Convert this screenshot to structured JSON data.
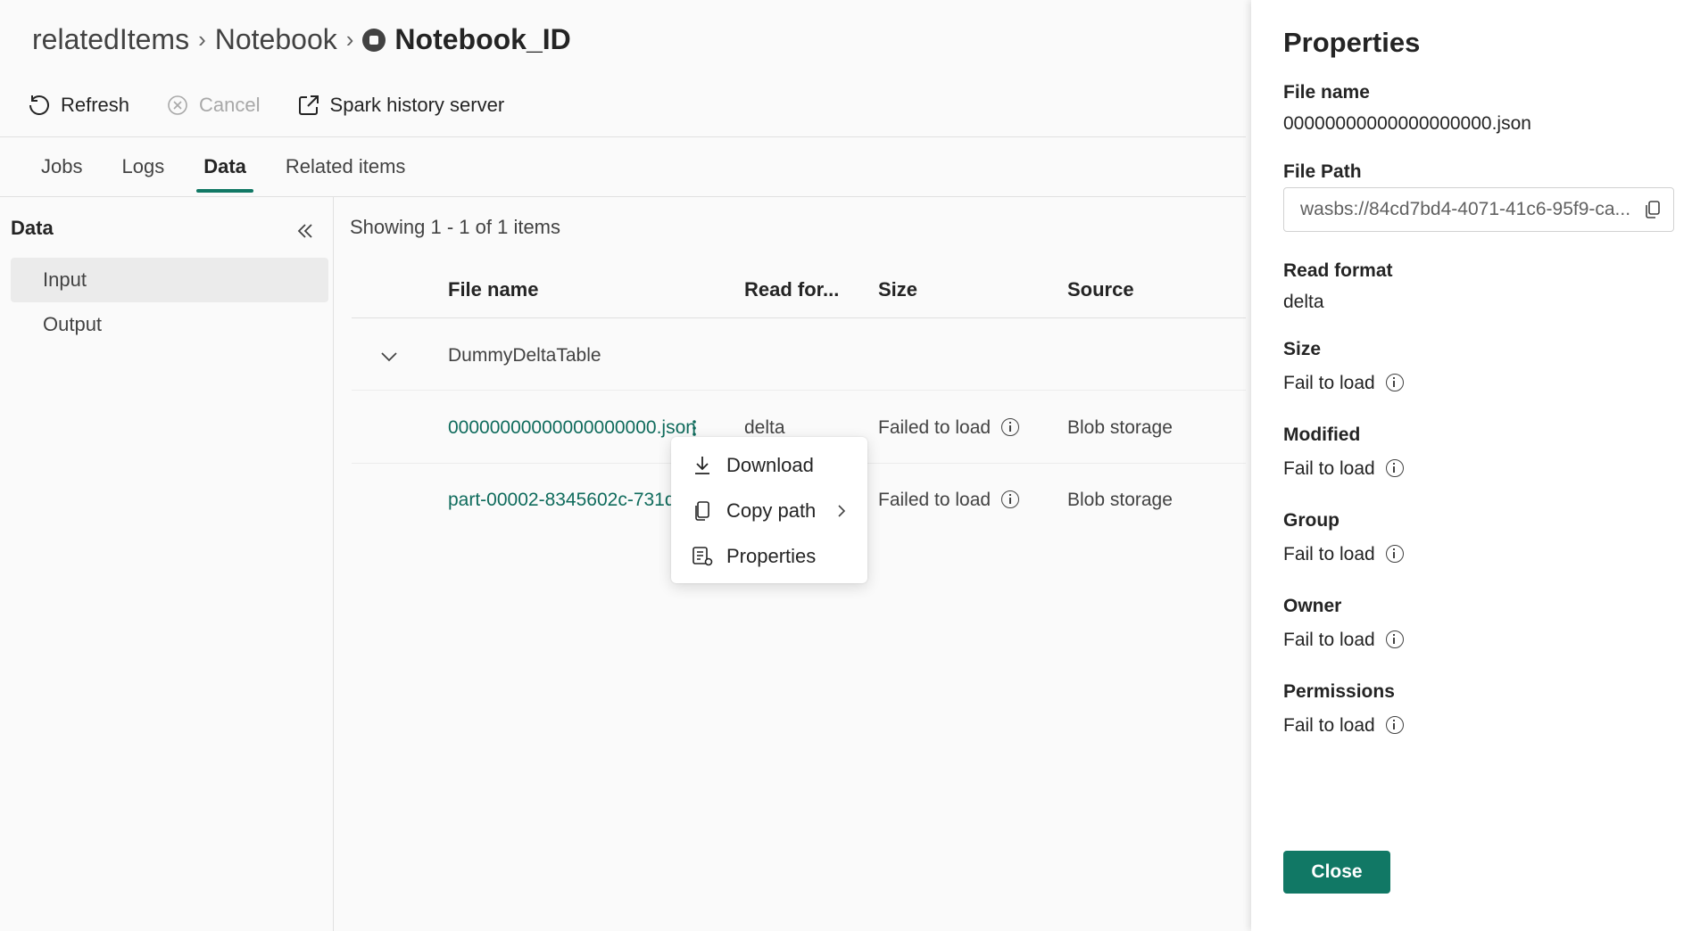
{
  "breadcrumb": {
    "item1": "relatedItems",
    "item2": "Notebook",
    "current": "Notebook_ID"
  },
  "toolbar": {
    "refresh": "Refresh",
    "cancel": "Cancel",
    "spark": "Spark history server"
  },
  "tabs": [
    "Jobs",
    "Logs",
    "Data",
    "Related items"
  ],
  "active_tab": "Data",
  "data_panel": {
    "title": "Data",
    "items": [
      "Input",
      "Output"
    ],
    "selected": "Input"
  },
  "list": {
    "showing": "Showing 1 - 1 of 1 items",
    "headers": {
      "file_name": "File name",
      "read_format": "Read for...",
      "size": "Size",
      "source": "Source"
    },
    "group": "DummyDeltaTable",
    "rows": [
      {
        "file": "00000000000000000000.json",
        "format": "delta",
        "size": "Failed to load",
        "source": "Blob storage"
      },
      {
        "file": "part-00002-8345602c-731d...",
        "format": "",
        "size": "Failed to load",
        "source": "Blob storage"
      }
    ]
  },
  "context_menu": {
    "download": "Download",
    "copy_path": "Copy path",
    "properties": "Properties"
  },
  "properties": {
    "title": "Properties",
    "file_name_label": "File name",
    "file_name": "00000000000000000000.json",
    "file_path_label": "File Path",
    "file_path": "wasbs://84cd7bd4-4071-41c6-95f9-ca...",
    "read_format_label": "Read format",
    "read_format": "delta",
    "size_label": "Size",
    "size": "Fail to load",
    "modified_label": "Modified",
    "modified": "Fail to load",
    "group_label": "Group",
    "group": "Fail to load",
    "owner_label": "Owner",
    "owner": "Fail to load",
    "permissions_label": "Permissions",
    "permissions": "Fail to load",
    "close": "Close"
  },
  "colors": {
    "accent": "#117865",
    "link": "#0f6b5c"
  }
}
